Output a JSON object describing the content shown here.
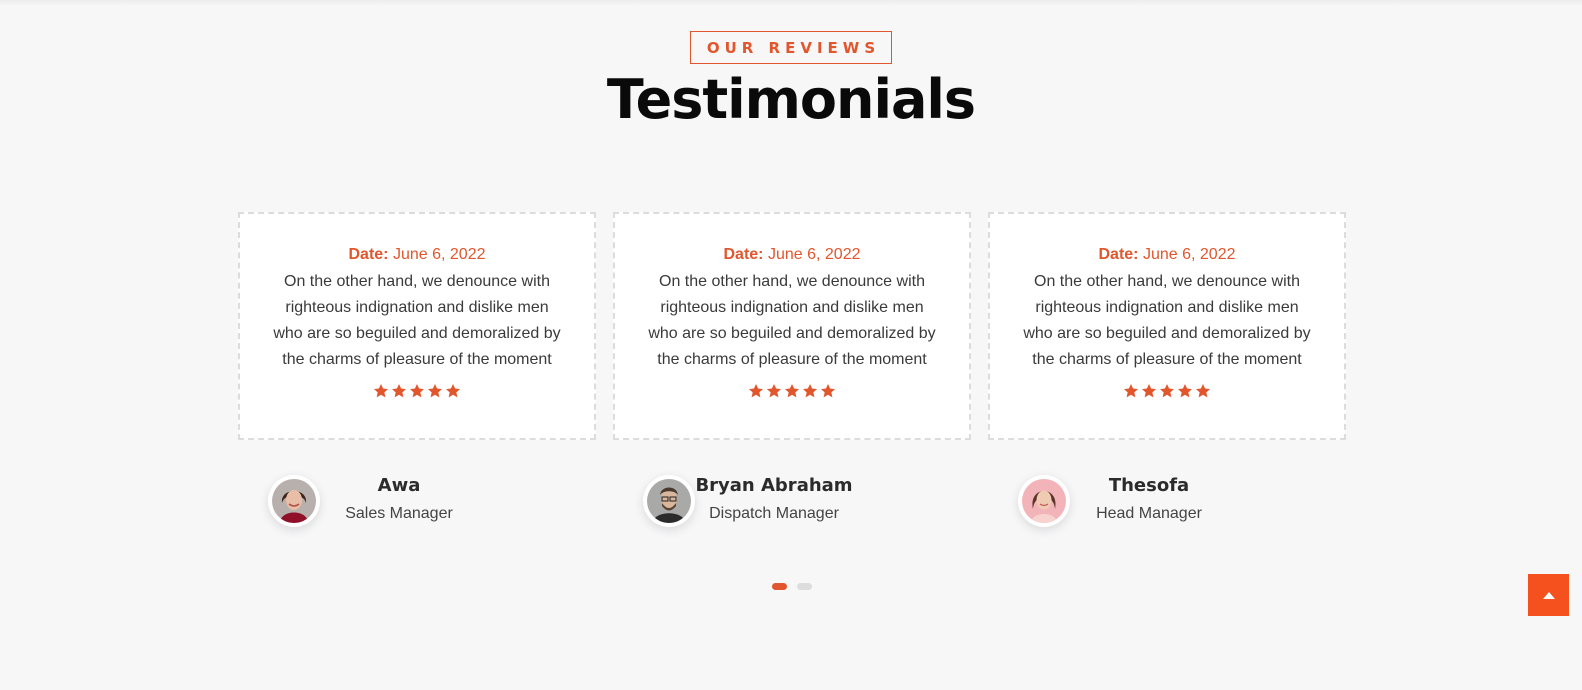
{
  "section": {
    "tag": "OUR REVIEWS",
    "title": "Testimonials"
  },
  "testimonials": [
    {
      "date_label": "Date:",
      "date": "June 6, 2022",
      "text": "On the other hand, we denounce with righteous indignation and dislike men who are so beguiled and demoralized by the charms of pleasure of the moment",
      "rating": 5,
      "name": "Awa",
      "role": "Sales Manager"
    },
    {
      "date_label": "Date:",
      "date": "June 6, 2022",
      "text": "On the other hand, we denounce with righteous indignation and dislike men who are so beguiled and demoralized by the charms of pleasure of the moment",
      "rating": 5,
      "name": "Bryan Abraham",
      "role": "Dispatch Manager"
    },
    {
      "date_label": "Date:",
      "date": "June 6, 2022",
      "text": "On the other hand, we denounce with righteous indignation and dislike men who are so beguiled and demoralized by the charms of pleasure of the moment",
      "rating": 5,
      "name": "Thesofa",
      "role": "Head Manager"
    }
  ],
  "pagination": {
    "pages": 2,
    "active": 1
  },
  "colors": {
    "accent": "#e2562d",
    "scroll_button": "#f4511e"
  },
  "icons": {
    "star": "star-icon",
    "scroll_top": "arrow-up-icon"
  }
}
